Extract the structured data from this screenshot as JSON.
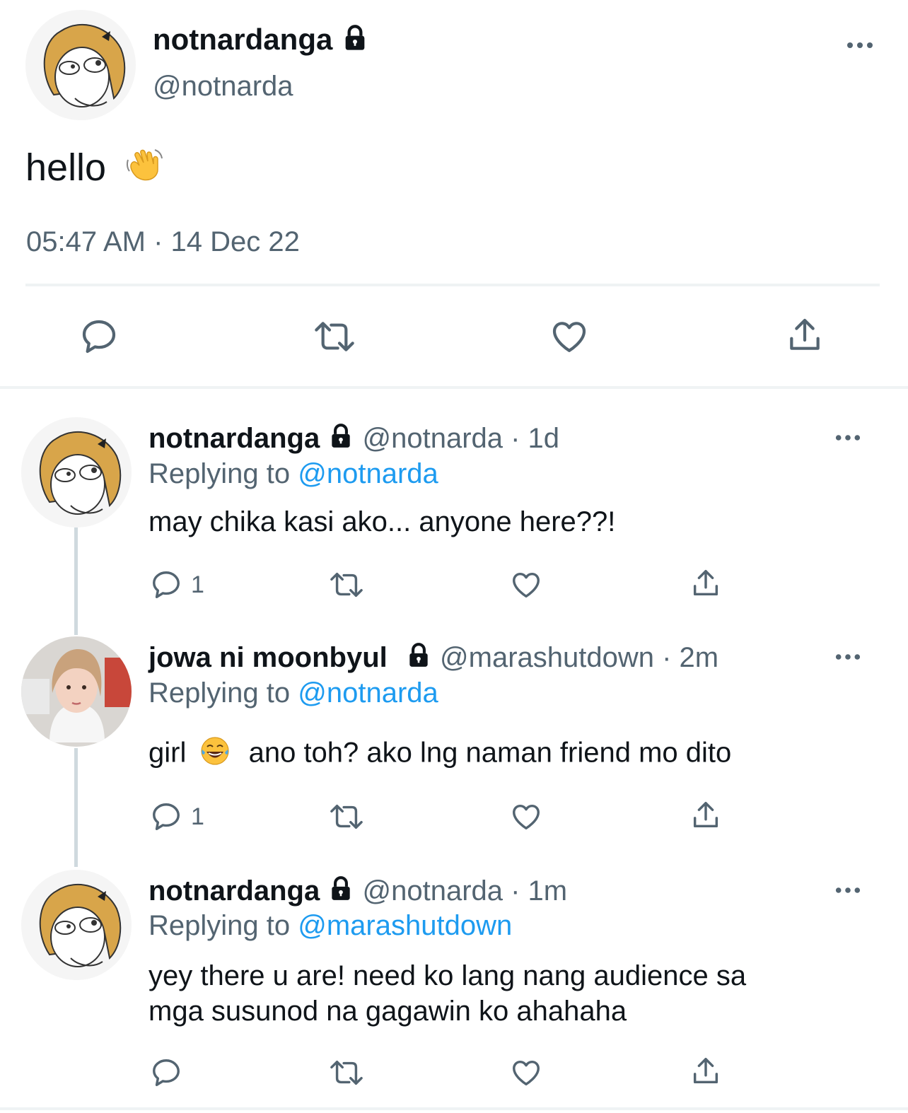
{
  "main_tweet": {
    "display_name": "notnardanga",
    "handle": "@notnarda",
    "text": "hello",
    "emoji": "waving-hand",
    "timestamp": "05:47 AM · 14 Dec 22"
  },
  "replies": [
    {
      "display_name": "notnardanga",
      "handle_time": "@notnarda · 1d",
      "replying_prefix": "Replying to",
      "replying_to": "@notnarda",
      "text": "may chika kasi ako... anyone here??!",
      "reply_count": "1"
    },
    {
      "display_name": "jowa ni moonbyul",
      "handle_time": "@marashutdown · 2m",
      "replying_prefix": "Replying to",
      "replying_to": "@notnarda",
      "text_before_emoji": "girl",
      "emoji": "face-with-tears-of-joy",
      "text_after_emoji": "ano toh? ako lng naman friend mo dito",
      "reply_count": "1"
    },
    {
      "display_name": "notnardanga",
      "handle_time": "@notnarda · 1m",
      "replying_prefix": "Replying to",
      "replying_to": "@marashutdown",
      "text_line1": "yey there u are! need ko lang nang audience sa",
      "text_line2": "mga susunod na gagawin ko ahahaha",
      "reply_count": ""
    }
  ],
  "colors": {
    "text": "#0f1419",
    "secondary": "#536471",
    "link": "#1d9bf0",
    "divider": "#eff3f4",
    "thread_line": "#cfd9de"
  }
}
